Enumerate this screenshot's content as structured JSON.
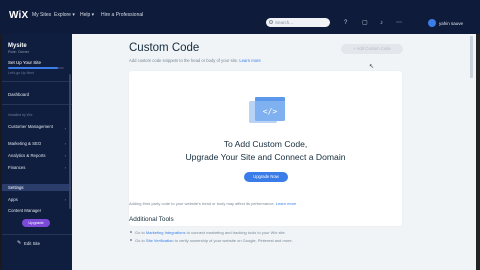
{
  "topbar": {
    "logo": "WiX",
    "nav": [
      "My Sites",
      "Explore ▾",
      "Help ▾",
      "Hire a Professional"
    ],
    "search_placeholder": "Search...",
    "user": "yahin sauve"
  },
  "sidebar": {
    "site_name": "Mysite",
    "site_role": "Role: Owner",
    "setup_label": "Set Up Your Site",
    "setup_progress": 0.9,
    "progress_label": "Let's go Up Next",
    "items": [
      {
        "label": "Dashboard",
        "section": false,
        "chevron": false
      },
      {
        "label": "Installed by Wix",
        "section": true,
        "chevron": false
      },
      {
        "label": "Customer Management",
        "section": false,
        "chevron": true
      },
      {
        "label": "Marketing & SEO",
        "section": false,
        "chevron": true
      },
      {
        "label": "Analytics & Reports",
        "section": false,
        "chevron": true
      },
      {
        "label": "Finances",
        "section": false,
        "chevron": true
      },
      {
        "label": "Settings",
        "section": false,
        "chevron": false
      },
      {
        "label": "Apps",
        "section": false,
        "chevron": true
      },
      {
        "label": "Content Manager",
        "section": false,
        "chevron": false
      }
    ],
    "upgrade_label": "Upgrade",
    "edit_site_label": "Edit Site"
  },
  "main": {
    "title": "Custom Code",
    "description": "Add custom code snippets to the head or body of your site.",
    "description_link": "Learn more",
    "add_button": "+ Add Custom Code",
    "card": {
      "heading_line1": "To Add Custom Code,",
      "heading_line2": "Upgrade Your Site and Connect a Domain",
      "button": "Upgrade Now"
    },
    "note": "Adding third party code to your website's head or body may affect its performance.",
    "note_link": "Learn more",
    "tools_title": "Additional Tools",
    "tools": [
      {
        "prefix": "Go to",
        "link": "Marketing Integrations",
        "suffix": "to connect marketing and tracking tools to your Wix site."
      },
      {
        "prefix": "Go to",
        "link": "Site Verification",
        "suffix": "to verify ownership of your website on Google, Pinterest and more."
      }
    ]
  },
  "colors": {
    "topbar": "#0e1b3a",
    "sidebar": "#0f1d3e",
    "accent": "#3b7de8",
    "upgrade": "#7b4bd8",
    "background": "#f0f4f7"
  }
}
